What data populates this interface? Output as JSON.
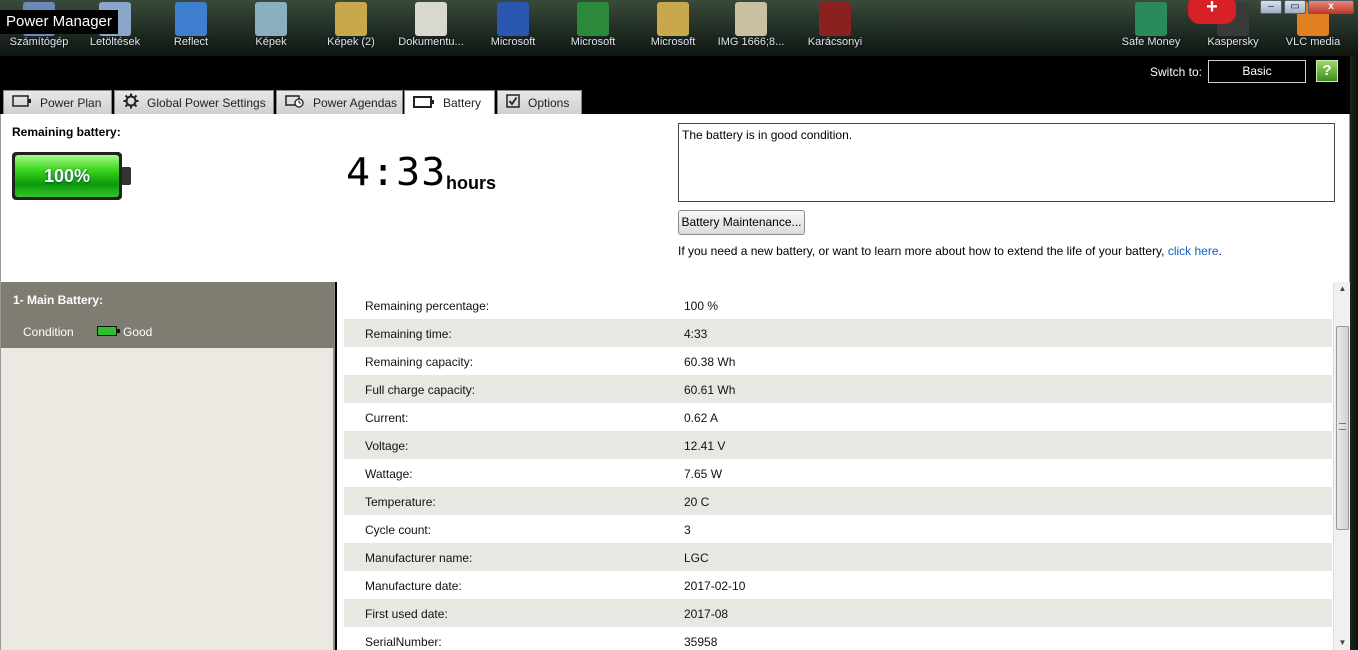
{
  "window": {
    "title": "Power Manager",
    "controls": [
      "–",
      "▭",
      "x"
    ]
  },
  "desktop_icons": [
    {
      "label": "Számítógép",
      "color": "#6a88b8"
    },
    {
      "label": "Letöltések",
      "color": "#8aa6c8"
    },
    {
      "label": "Reflect",
      "color": "#3f7fd0"
    },
    {
      "label": "Képek",
      "color": "#8ab0c0"
    },
    {
      "label": "Képek (2)",
      "color": "#c9a84c"
    },
    {
      "label": "Dokumentu...",
      "color": "#d8d8d0"
    },
    {
      "label": "Microsoft",
      "color": "#2a58b0"
    },
    {
      "label": "Microsoft",
      "color": "#2a8a3a"
    },
    {
      "label": "Microsoft",
      "color": "#c9a84c"
    },
    {
      "label": "IMG 1666;8...",
      "color": "#c8c0a0"
    },
    {
      "label": "Karácsonyi",
      "color": "#8a2020"
    },
    {
      "label": "Safe Money",
      "color": "#2a8a5a"
    },
    {
      "label": "Kaspersky",
      "color": "#3a3a3a"
    },
    {
      "label": "VLC media",
      "color": "#e08020"
    }
  ],
  "header": {
    "switch_label": "Switch to:",
    "switch_value": "Basic",
    "help_label": "?"
  },
  "tabs": [
    {
      "label": "Power Plan",
      "icon": "battery-outline-icon"
    },
    {
      "label": "Global Power Settings",
      "icon": "gear-icon"
    },
    {
      "label": "Power Agendas",
      "icon": "clock-icon"
    },
    {
      "label": "Battery",
      "icon": "battery-icon"
    },
    {
      "label": "Options",
      "icon": "checkbox-icon"
    }
  ],
  "summary": {
    "remaining_label": "Remaining battery:",
    "percent_text": "100%",
    "percent_level": 100,
    "time": "4:33",
    "time_unit": "hours",
    "status_message": "The battery is in good condition.",
    "maintenance_button": "Battery Maintenance...",
    "info_text": "If you need a new battery, or want to learn more about how to extend the life of your battery, ",
    "info_link": "click here",
    "info_end": "."
  },
  "battery_list": {
    "title": "1- Main Battery:",
    "condition_label": "Condition",
    "condition_value": "Good"
  },
  "details": [
    {
      "key": "Remaining percentage:",
      "value": "100 %"
    },
    {
      "key": "Remaining time:",
      "value": "4:33"
    },
    {
      "key": "Remaining capacity:",
      "value": "60.38 Wh"
    },
    {
      "key": "Full charge capacity:",
      "value": "60.61 Wh"
    },
    {
      "key": "Current:",
      "value": "0.62 A"
    },
    {
      "key": "Voltage:",
      "value": "12.41 V"
    },
    {
      "key": "Wattage:",
      "value": "7.65 W"
    },
    {
      "key": "Temperature:",
      "value": "20 C"
    },
    {
      "key": "Cycle count:",
      "value": "3"
    },
    {
      "key": "Manufacturer name:",
      "value": "LGC"
    },
    {
      "key": "Manufacture date:",
      "value": "2017-02-10"
    },
    {
      "key": "First used date:",
      "value": "2017-08"
    },
    {
      "key": "SerialNumber:",
      "value": "35958"
    }
  ]
}
